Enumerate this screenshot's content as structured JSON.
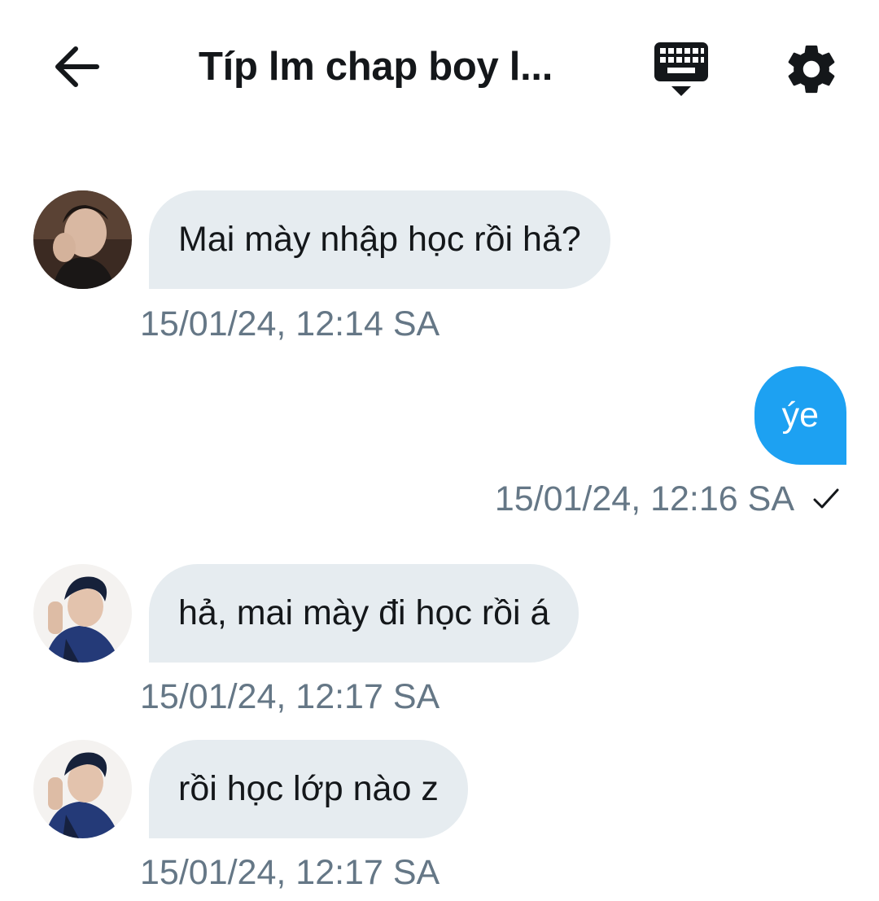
{
  "header": {
    "title": "Típ lm chap boy l...",
    "back_icon": "arrow-left-icon",
    "keyboard_icon": "keyboard-hide-icon",
    "settings_icon": "gear-icon"
  },
  "colors": {
    "incoming_bubble": "#e6ecf0",
    "outgoing_bubble": "#1da1f2",
    "timestamp": "#657786",
    "text": "#14171a"
  },
  "messages": [
    {
      "direction": "incoming",
      "text": "Mai mày nhập học rồi hả?",
      "time": "15/01/24, 12:14 SA"
    },
    {
      "direction": "outgoing",
      "text": "ýe",
      "time": "15/01/24, 12:16 SA",
      "status_icon": "checkmark-icon"
    },
    {
      "direction": "incoming",
      "text": "hả, mai mày đi học rồi á",
      "time": "15/01/24, 12:17 SA"
    },
    {
      "direction": "incoming",
      "text": "rồi học lớp nào z",
      "time": "15/01/24, 12:17 SA"
    }
  ]
}
